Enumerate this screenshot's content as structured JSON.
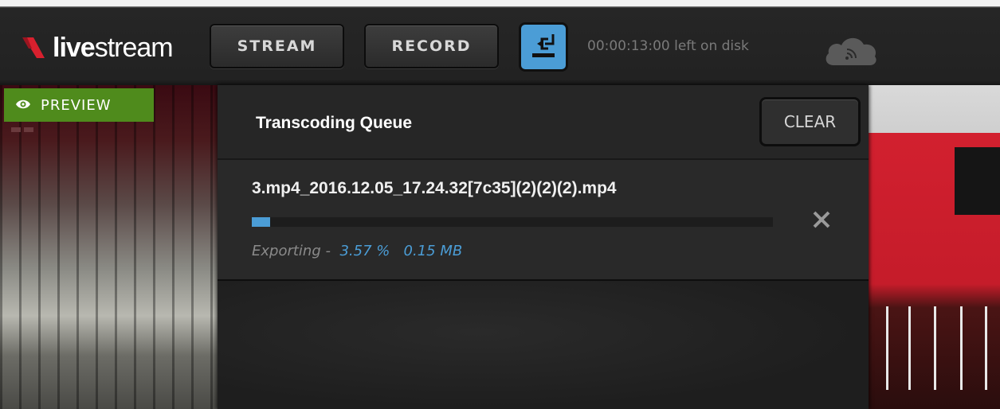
{
  "header": {
    "logo_text_bold": "live",
    "logo_text_regular": "stream",
    "stream_label": "STREAM",
    "record_label": "RECORD",
    "transcode_icon": "transcode-queue-icon",
    "disk_status": "00:00:13:00 left on disk",
    "cloud_icon": "cloud-rss-icon"
  },
  "preview": {
    "badge_label": "PREVIEW",
    "badge_icon": "eye-icon"
  },
  "panel": {
    "title": "Transcoding Queue",
    "clear_label": "CLEAR",
    "items": [
      {
        "file_name": "3.mp4_2016.12.05_17.24.32[7c35](2)(2)(2).mp4",
        "status": "Exporting",
        "separator": "-",
        "percent_text": "3.57 %",
        "size_text": "0.15 MB",
        "progress_fraction": 0.0357,
        "remove_icon": "close-icon"
      }
    ]
  },
  "colors": {
    "accent_blue": "#4b9dd6",
    "preview_green": "#4f8b1c",
    "logo_red": "#d8202e"
  }
}
